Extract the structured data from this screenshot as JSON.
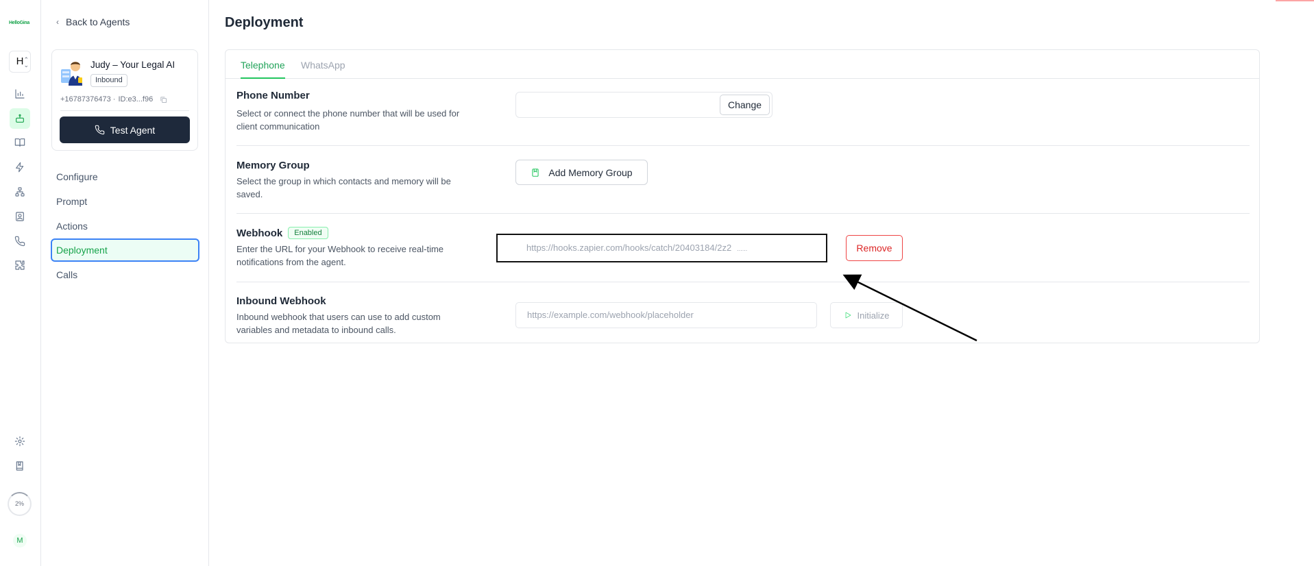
{
  "rail": {
    "logo_text": "HelloGina",
    "workspace_initial": "H",
    "usage_percent": "2%",
    "user_initial": "M",
    "items": [
      {
        "icon": "bar-chart-icon"
      },
      {
        "icon": "bot-icon",
        "active": true
      },
      {
        "icon": "book-open-icon"
      },
      {
        "icon": "zap-icon"
      },
      {
        "icon": "workflow-icon"
      },
      {
        "icon": "contact-card-icon"
      },
      {
        "icon": "phone-icon"
      },
      {
        "icon": "puzzle-icon"
      }
    ],
    "bottom_items": [
      {
        "icon": "settings-icon"
      },
      {
        "icon": "docs-book-icon"
      }
    ]
  },
  "sidebar": {
    "back_label": "Back to Agents",
    "agent": {
      "name": "Judy – Your Legal AI",
      "direction": "Inbound",
      "phone": "+16787376473 ·",
      "id": "ID:e3...f96",
      "test_label": "Test Agent"
    },
    "nav": [
      {
        "label": "Configure"
      },
      {
        "label": "Prompt"
      },
      {
        "label": "Actions"
      },
      {
        "label": "Deployment",
        "active": true
      },
      {
        "label": "Calls"
      }
    ]
  },
  "main": {
    "title": "Deployment",
    "tabs": [
      {
        "label": "Telephone",
        "active": true
      },
      {
        "label": "WhatsApp"
      }
    ],
    "phone": {
      "title": "Phone Number",
      "desc": "Select or connect the phone number that will be used for client communication",
      "value": "",
      "change_label": "Change"
    },
    "memory": {
      "title": "Memory Group",
      "desc": "Select the group in which contacts and memory will be saved.",
      "button_label": "Add Memory Group"
    },
    "webhook": {
      "title": "Webhook",
      "badge": "Enabled",
      "desc": "Enter the URL for your Webhook to receive real-time notifications from the agent.",
      "url": "https://hooks.zapier.com/hooks/catch/20403184/2z2",
      "url_tail": "......",
      "remove_label": "Remove"
    },
    "inbound": {
      "title": "Inbound Webhook",
      "desc": "Inbound webhook that users can use to add custom variables and metadata to inbound calls.",
      "placeholder": "https://example.com/webhook/placeholder",
      "init_label": "Initialize"
    }
  },
  "colors": {
    "accent": "#22c55e",
    "danger": "#dc2626",
    "dark_button": "#1e293b"
  }
}
